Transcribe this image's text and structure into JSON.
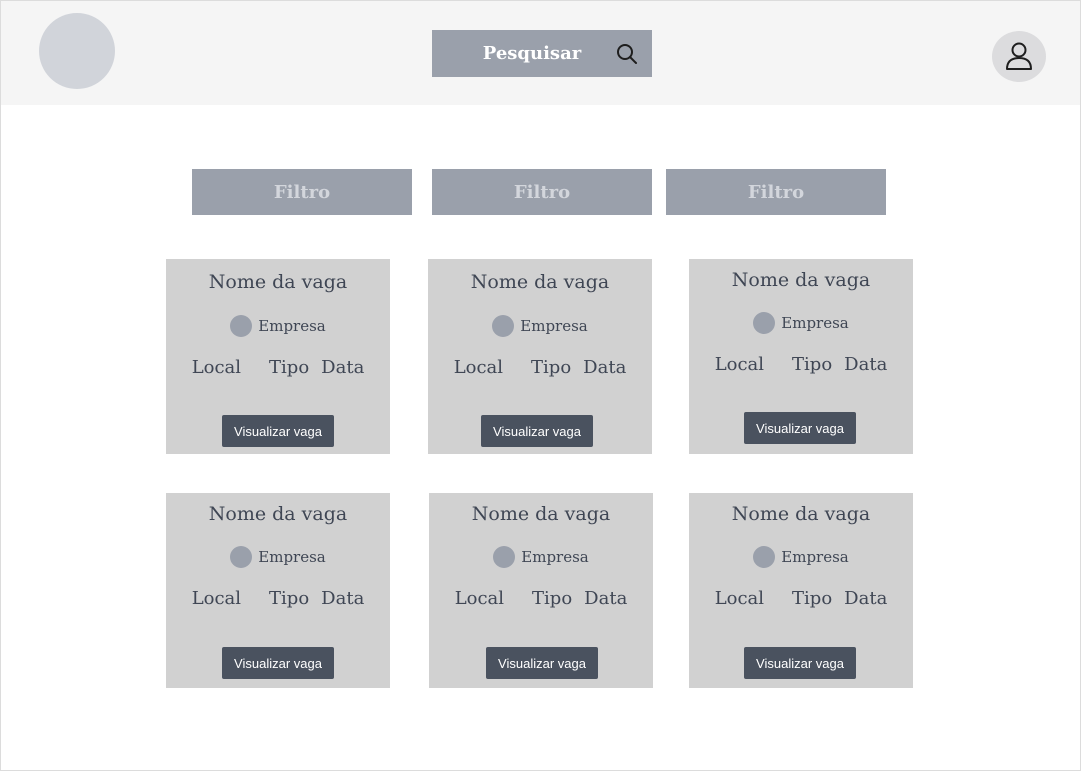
{
  "header": {
    "search_label": "Pesquisar"
  },
  "filters": [
    "Filtro",
    "Filtro",
    "Filtro"
  ],
  "cards": [
    {
      "title": "Nome da vaga",
      "company": "Empresa",
      "local": "Local",
      "tipo": "Tipo",
      "data": "Data",
      "button": "Visualizar vaga"
    },
    {
      "title": "Nome da vaga",
      "company": "Empresa",
      "local": "Local",
      "tipo": "Tipo",
      "data": "Data",
      "button": "Visualizar vaga"
    },
    {
      "title": "Nome da vaga",
      "company": "Empresa",
      "local": "Local",
      "tipo": "Tipo",
      "data": "Data",
      "button": "Visualizar vaga"
    },
    {
      "title": "Nome da vaga",
      "company": "Empresa",
      "local": "Local",
      "tipo": "Tipo",
      "data": "Data",
      "button": "Visualizar vaga"
    },
    {
      "title": "Nome da vaga",
      "company": "Empresa",
      "local": "Local",
      "tipo": "Tipo",
      "data": "Data",
      "button": "Visualizar vaga"
    },
    {
      "title": "Nome da vaga",
      "company": "Empresa",
      "local": "Local",
      "tipo": "Tipo",
      "data": "Data",
      "button": "Visualizar vaga"
    }
  ],
  "colors": {
    "header_bg": "#f5f5f5",
    "filter_bg": "#9aa0ab",
    "card_bg": "#d1d1d1",
    "button_bg": "#4a525f"
  }
}
